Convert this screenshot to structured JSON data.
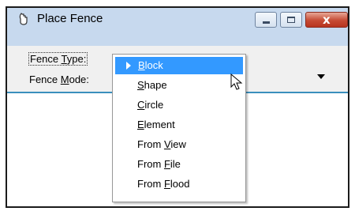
{
  "window": {
    "title": "Place Fence",
    "icon": "fence-tool-icon",
    "buttons": {
      "minimize": "minimize-icon",
      "maximize": "maximize-icon",
      "close": "close-icon",
      "close_glyph": "x"
    }
  },
  "form": {
    "fence_type_label_pre": "Fence ",
    "fence_type_label_key": "T",
    "fence_type_label_post": "ype:",
    "fence_mode_label_pre": "Fence ",
    "fence_mode_label_key": "M",
    "fence_mode_label_post": "ode:"
  },
  "dropdown": {
    "selected_index": 0,
    "items": [
      {
        "pre": "",
        "key": "B",
        "post": "lock"
      },
      {
        "pre": "",
        "key": "S",
        "post": "hape"
      },
      {
        "pre": "",
        "key": "C",
        "post": "ircle"
      },
      {
        "pre": "",
        "key": "E",
        "post": "lement"
      },
      {
        "pre": "From ",
        "key": "V",
        "post": "iew"
      },
      {
        "pre": "From ",
        "key": "F",
        "post": "ile"
      },
      {
        "pre": "From ",
        "key": "F",
        "post": "lood"
      }
    ]
  },
  "colors": {
    "selection": "#3399ff",
    "titlebar": "#c7d9ee",
    "panel": "#f0f0f0",
    "accent_line": "#3a8fbd"
  }
}
